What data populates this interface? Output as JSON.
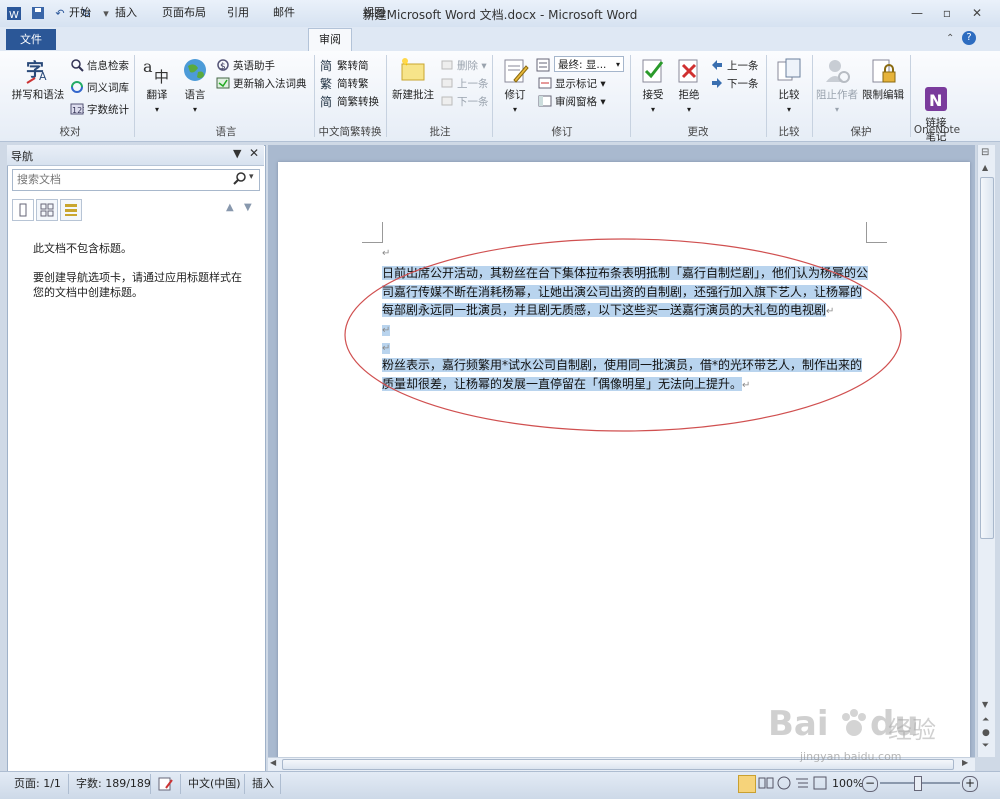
{
  "window": {
    "title": "新建Microsoft Word 文档.docx - Microsoft Word"
  },
  "tabs": {
    "file": "文件",
    "home": "开始",
    "insert": "插入",
    "layout": "页面布局",
    "references": "引用",
    "mailings": "邮件",
    "review": "审阅",
    "view": "视图"
  },
  "ribbon": {
    "proofing": {
      "label": "校对",
      "spelling": "拼写和语法",
      "research": "信息检索",
      "thesaurus": "同义词库",
      "wordcount": "字数统计"
    },
    "language": {
      "label": "语言",
      "translate": "翻译",
      "language": "语言",
      "english_assistant": "英语助手",
      "update_ime": "更新输入法词典"
    },
    "chinese": {
      "label": "中文简繁转换",
      "to_simplified": "繁转简",
      "to_traditional": "简转繁",
      "convert": "简繁转换"
    },
    "comments": {
      "label": "批注",
      "new": "新建批注",
      "delete": "删除",
      "previous": "上一条",
      "next": "下一条"
    },
    "tracking": {
      "label": "修订",
      "track": "修订",
      "final": "最终: 显...",
      "show_markup": "显示标记",
      "review_pane": "审阅窗格"
    },
    "changes": {
      "label": "更改",
      "accept": "接受",
      "reject": "拒绝",
      "previous": "上一条",
      "next": "下一条"
    },
    "compare": {
      "label": "比较",
      "compare": "比较"
    },
    "protect": {
      "label": "保护",
      "block_authors": "阻止作者",
      "restrict": "限制编辑"
    },
    "onenote": {
      "label": "OneNote",
      "linked_notes": "链接\n笔记"
    }
  },
  "nav": {
    "title": "导航",
    "search_placeholder": "搜索文档",
    "msg1": "此文档不包含标题。",
    "msg2": "要创建导航选项卡，请通过应用标题样式在您的文档中创建标题。"
  },
  "document": {
    "p1": "日前出席公开活动，其粉丝在台下集体拉布条表明抵制「嘉行自制烂剧」，他们认为杨幂的公司嘉行传媒不断在消耗杨幂，让她出演公司出资的自制剧，还强行加入旗下艺人，让杨幂的每部剧永远同一批演员，并且剧无质感，以下这些买一送嘉行演员的大礼包的电视剧",
    "p2": "粉丝表示，嘉行频繁用*试水公司自制剧，使用同一批演员，借*的光环带艺人，制作出来的质量却很差，让杨幂的发展一直停留在「偶像明星」无法向上提升。",
    "para_mark": "↵"
  },
  "status": {
    "page": "页面: 1/1",
    "words": "字数: 189/189",
    "language": "中文(中国)",
    "mode": "插入",
    "zoom": "100%"
  },
  "watermark": {
    "brand": "Bai",
    "brand2": "du",
    "chinese": "经验",
    "url": "jingyan.baidu.com"
  },
  "colors": {
    "file_tab": "#2b5797",
    "selection": "#b9d4ee",
    "ellipse": "#d05050"
  }
}
